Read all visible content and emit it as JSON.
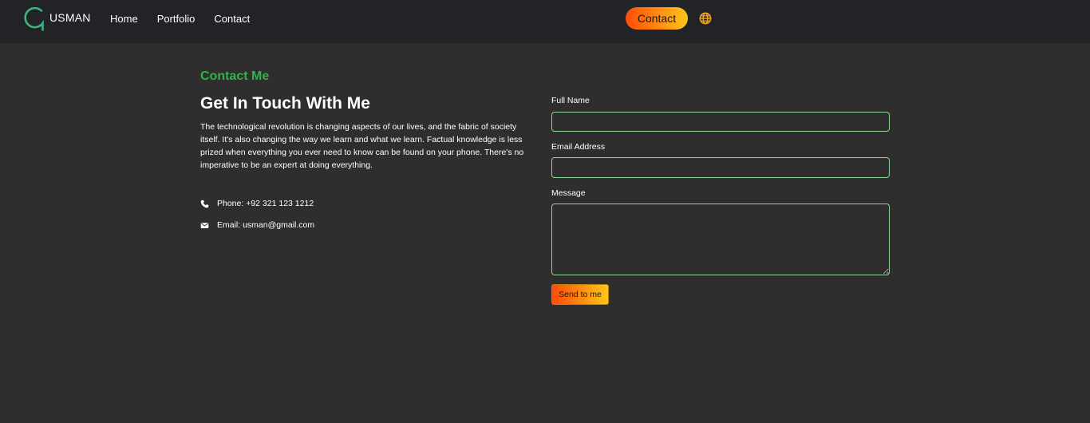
{
  "brand": {
    "name": "USMAN",
    "logo_icon": "g-ring-logo",
    "accent": "#3fb37f"
  },
  "nav": {
    "links": [
      {
        "label": "Home"
      },
      {
        "label": "Portfolio"
      },
      {
        "label": "Contact"
      }
    ],
    "cta_label": "Contact",
    "language_icon": "globe-icon"
  },
  "section": {
    "eyebrow": "Contact Me",
    "heading": "Get In Touch With Me",
    "intro": "The technological revolution is changing aspects of our lives, and the fabric of society itself. It's also changing the way we learn and what we learn. Factual knowledge is less prized when everything you ever need to know can be found on your phone. There's no imperative to be an expert at doing everything."
  },
  "contact_info": {
    "phone_icon": "phone-icon",
    "phone_text": "Phone: +92 321 123 1212",
    "email_icon": "envelope-icon",
    "email_text": "Email: usman@gmail.com"
  },
  "form": {
    "full_name_label": "Full Name",
    "full_name_value": "",
    "email_label": "Email Address",
    "email_value": "",
    "message_label": "Message",
    "message_value": "",
    "submit_label": "Send to me"
  },
  "colors": {
    "background": "#2f2d2d",
    "navbar": "#212326",
    "eyebrow": "#2fb34a",
    "field_border": "#8fd89a",
    "gradient_start": "#ff4b0a",
    "gradient_end": "#ffc61a"
  }
}
